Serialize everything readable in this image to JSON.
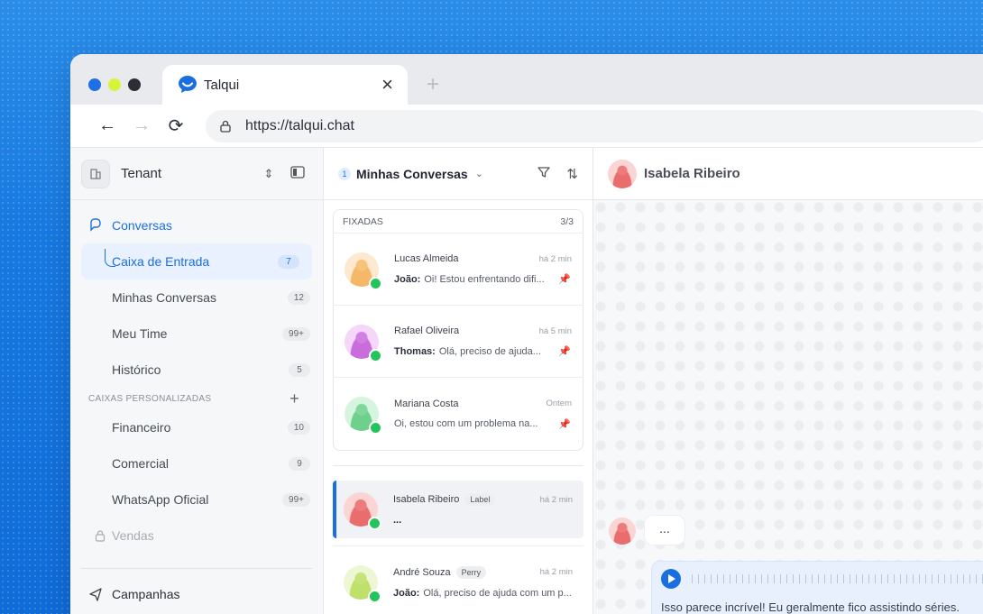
{
  "browser": {
    "tab_title": "Talqui",
    "url": "https://talqui.chat",
    "traffic_colors": [
      "#1f6fe5",
      "#d9f23a",
      "#2b2e35"
    ],
    "accent": "#1a6fe0"
  },
  "sidebar": {
    "tenant": "Tenant",
    "main_item": "Conversas",
    "items": [
      {
        "label": "Caixa de Entrada",
        "count": "7"
      },
      {
        "label": "Minhas Conversas",
        "count": "12"
      },
      {
        "label": "Meu Time",
        "count": "99+"
      },
      {
        "label": "Histórico",
        "count": "5"
      }
    ],
    "section_label": "CAIXAS PERSONALIZADAS",
    "custom_items": [
      {
        "label": "Financeiro",
        "count": "10"
      },
      {
        "label": "Comercial",
        "count": "9"
      },
      {
        "label": "WhatsApp Oficial",
        "count": "99+"
      }
    ],
    "locked_item": "Vendas",
    "campaigns": "Campanhas"
  },
  "convlist": {
    "badge": "1",
    "title": "Minhas Conversas",
    "pinned_label": "FIXADAS",
    "pinned_count": "3/3",
    "pinned": [
      {
        "name": "Lucas Almeida",
        "time": "há 2 min",
        "sender": "João:",
        "message": "Oi! Estou enfrentando difi..."
      },
      {
        "name": "Rafael Oliveira",
        "time": "há 5 min",
        "sender": "Thomas:",
        "message": "Olá, preciso de ajuda..."
      },
      {
        "name": "Mariana Costa",
        "time": "Ontem",
        "sender": "",
        "message": "Oi, estou com um problema na..."
      }
    ],
    "selected": {
      "name": "Isabela Ribeiro",
      "label": "Label",
      "time": "há 2 min",
      "message": "..."
    },
    "other": {
      "name": "André Souza",
      "label": "Perry",
      "time": "há 2 min",
      "sender": "João:",
      "message": "Olá, preciso de ajuda com um p..."
    }
  },
  "chat": {
    "contact": "Isabela Ribeiro",
    "typing": "...",
    "audio_text": "Isso parece incrível! Eu geralmente fico assistindo séries."
  }
}
